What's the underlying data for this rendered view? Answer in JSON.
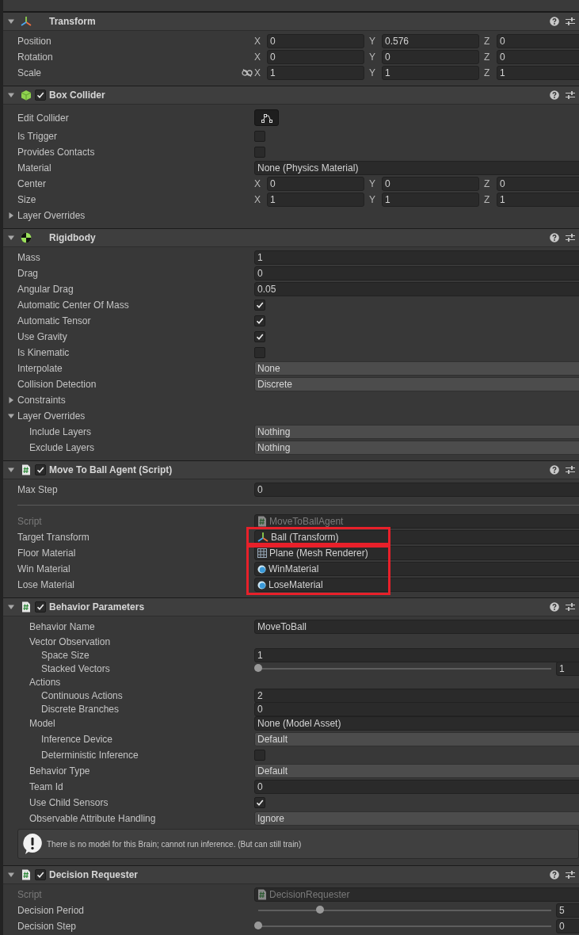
{
  "components": [
    {
      "title": "Transform",
      "kind": "transform",
      "rows": [
        {
          "kind": "vector3",
          "label": "Position",
          "axes": [
            {
              "label": "X",
              "value": "0"
            },
            {
              "label": "Y",
              "value": "0.576"
            },
            {
              "label": "Z",
              "value": "0"
            }
          ]
        },
        {
          "kind": "vector3",
          "label": "Rotation",
          "axes": [
            {
              "label": "X",
              "value": "0"
            },
            {
              "label": "Y",
              "value": "0"
            },
            {
              "label": "Z",
              "value": "0"
            }
          ]
        },
        {
          "kind": "vector3",
          "label": "Scale",
          "axes": [
            {
              "label": "X",
              "value": "1"
            },
            {
              "label": "Y",
              "value": "1"
            },
            {
              "label": "Z",
              "value": "1"
            }
          ],
          "proportions_locked": false
        }
      ]
    },
    {
      "title": "Box Collider",
      "kind": "box_collider",
      "enabled": true,
      "rows": [
        {
          "kind": "button",
          "label": "Edit Collider"
        },
        {
          "kind": "checkbox",
          "label": "Is Trigger",
          "checked": false
        },
        {
          "kind": "checkbox",
          "label": "Provides Contacts",
          "checked": false
        },
        {
          "kind": "object",
          "label": "Material",
          "value": "None (Physics Material)",
          "disabled": false
        },
        {
          "kind": "vector3",
          "label": "Center",
          "axes": [
            {
              "label": "X",
              "value": "0"
            },
            {
              "label": "Y",
              "value": "0"
            },
            {
              "label": "Z",
              "value": "0"
            }
          ]
        },
        {
          "kind": "vector3",
          "label": "Size",
          "axes": [
            {
              "label": "X",
              "value": "1"
            },
            {
              "label": "Y",
              "value": "1"
            },
            {
              "label": "Z",
              "value": "1"
            }
          ]
        },
        {
          "kind": "foldout",
          "label": "Layer Overrides",
          "expanded": false
        }
      ]
    },
    {
      "title": "Rigidbody",
      "kind": "rigidbody",
      "rows": [
        {
          "kind": "field",
          "label": "Mass",
          "value": "1"
        },
        {
          "kind": "field",
          "label": "Drag",
          "value": "0"
        },
        {
          "kind": "field",
          "label": "Angular Drag",
          "value": "0.05"
        },
        {
          "kind": "checkbox",
          "label": "Automatic Center Of Mass",
          "checked": true
        },
        {
          "kind": "checkbox",
          "label": "Automatic Tensor",
          "checked": true
        },
        {
          "kind": "checkbox",
          "label": "Use Gravity",
          "checked": true
        },
        {
          "kind": "checkbox",
          "label": "Is Kinematic",
          "checked": false
        },
        {
          "kind": "dropdown",
          "label": "Interpolate",
          "value": "None"
        },
        {
          "kind": "dropdown",
          "label": "Collision Detection",
          "value": "Discrete"
        },
        {
          "kind": "foldout",
          "label": "Constraints",
          "expanded": false
        },
        {
          "kind": "foldout",
          "label": "Layer Overrides",
          "expanded": true,
          "children": [
            {
              "kind": "dropdown",
              "label": "Include Layers",
              "value": "Nothing"
            },
            {
              "kind": "dropdown",
              "label": "Exclude Layers",
              "value": "Nothing"
            }
          ]
        }
      ]
    },
    {
      "title": "Move To Ball Agent (Script)",
      "kind": "script",
      "enabled": true,
      "rows": [
        {
          "kind": "field",
          "label": "Max Step",
          "value": "0"
        },
        {
          "kind": "separator"
        },
        {
          "kind": "script_ref",
          "label": "Script",
          "value": "MoveToBallAgent",
          "disabled": true
        },
        {
          "kind": "highlight_group",
          "rows": [
            {
              "kind": "transform_ref",
              "label": "Target Transform",
              "value": "Ball (Transform)",
              "disabled": false
            }
          ]
        },
        {
          "kind": "highlight_group",
          "rows": [
            {
              "kind": "mesh_ref",
              "label": "Floor Material",
              "value": "Plane (Mesh Renderer)",
              "disabled": false
            },
            {
              "kind": "material_ref",
              "label": "Win Material",
              "value": "WinMaterial",
              "disabled": false
            },
            {
              "kind": "material_ref",
              "label": "Lose Material",
              "value": "LoseMaterial",
              "disabled": false
            }
          ]
        }
      ]
    },
    {
      "title": "Behavior Parameters",
      "kind": "script",
      "enabled": true,
      "inset": true,
      "rows": [
        {
          "kind": "field",
          "label": "Behavior Name",
          "value": "MoveToBall"
        },
        {
          "kind": "label",
          "label": "Vector Observation",
          "children": [
            {
              "kind": "field",
              "label": "Space Size",
              "value": "1"
            },
            {
              "kind": "slider",
              "label": "Stacked Vectors",
              "level": 0,
              "value": "1"
            }
          ]
        },
        {
          "kind": "label",
          "label": "Actions",
          "children": [
            {
              "kind": "field",
              "label": "Continuous Actions",
              "value": "2"
            },
            {
              "kind": "field",
              "label": "Discrete Branches",
              "value": "0"
            }
          ]
        },
        {
          "kind": "object",
          "label": "Model",
          "value": "None (Model Asset)",
          "disabled": false,
          "children": [
            {
              "kind": "dropdown",
              "label": "Inference Device",
              "value": "Default"
            },
            {
              "kind": "checkbox",
              "label": "Deterministic Inference",
              "checked": false
            }
          ]
        },
        {
          "kind": "dropdown",
          "label": "Behavior Type",
          "value": "Default"
        },
        {
          "kind": "field",
          "label": "Team Id",
          "value": "0"
        },
        {
          "kind": "checkbox",
          "label": "Use Child Sensors",
          "checked": true
        },
        {
          "kind": "dropdown",
          "label": "Observable Attribute Handling",
          "value": "Ignore"
        },
        {
          "kind": "helpbox",
          "text": "There is no model for this Brain; cannot run inference. (But can still train)"
        }
      ]
    },
    {
      "title": "Decision Requester",
      "kind": "script",
      "enabled": true,
      "rows": [
        {
          "kind": "script_ref",
          "label": "Script",
          "value": "DecisionRequester",
          "disabled": true
        },
        {
          "kind": "slider",
          "label": "Decision Period",
          "level": 0.21,
          "value": "5"
        },
        {
          "kind": "slider",
          "label": "Decision Step",
          "level": 0,
          "value": "0"
        }
      ]
    }
  ]
}
